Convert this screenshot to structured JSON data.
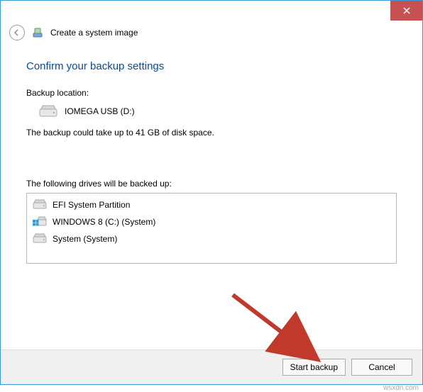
{
  "window": {
    "title": "Create a system image"
  },
  "page": {
    "heading": "Confirm your backup settings"
  },
  "backup_location": {
    "label": "Backup location:",
    "name": "IOMEGA USB (D:)"
  },
  "size_note": "The backup could take up to 41 GB of disk space.",
  "drives_section": {
    "label": "The following drives will be backed up:",
    "items": [
      {
        "label": "EFI System Partition",
        "icon": "drive"
      },
      {
        "label": "WINDOWS 8 (C:) (System)",
        "icon": "win-drive"
      },
      {
        "label": "System (System)",
        "icon": "drive"
      }
    ]
  },
  "buttons": {
    "start": "Start backup",
    "cancel": "Cancel"
  },
  "watermark": "wsxdn.com",
  "colors": {
    "accent": "#0a4b8f",
    "close": "#c75050",
    "arrow": "#c0392b"
  }
}
